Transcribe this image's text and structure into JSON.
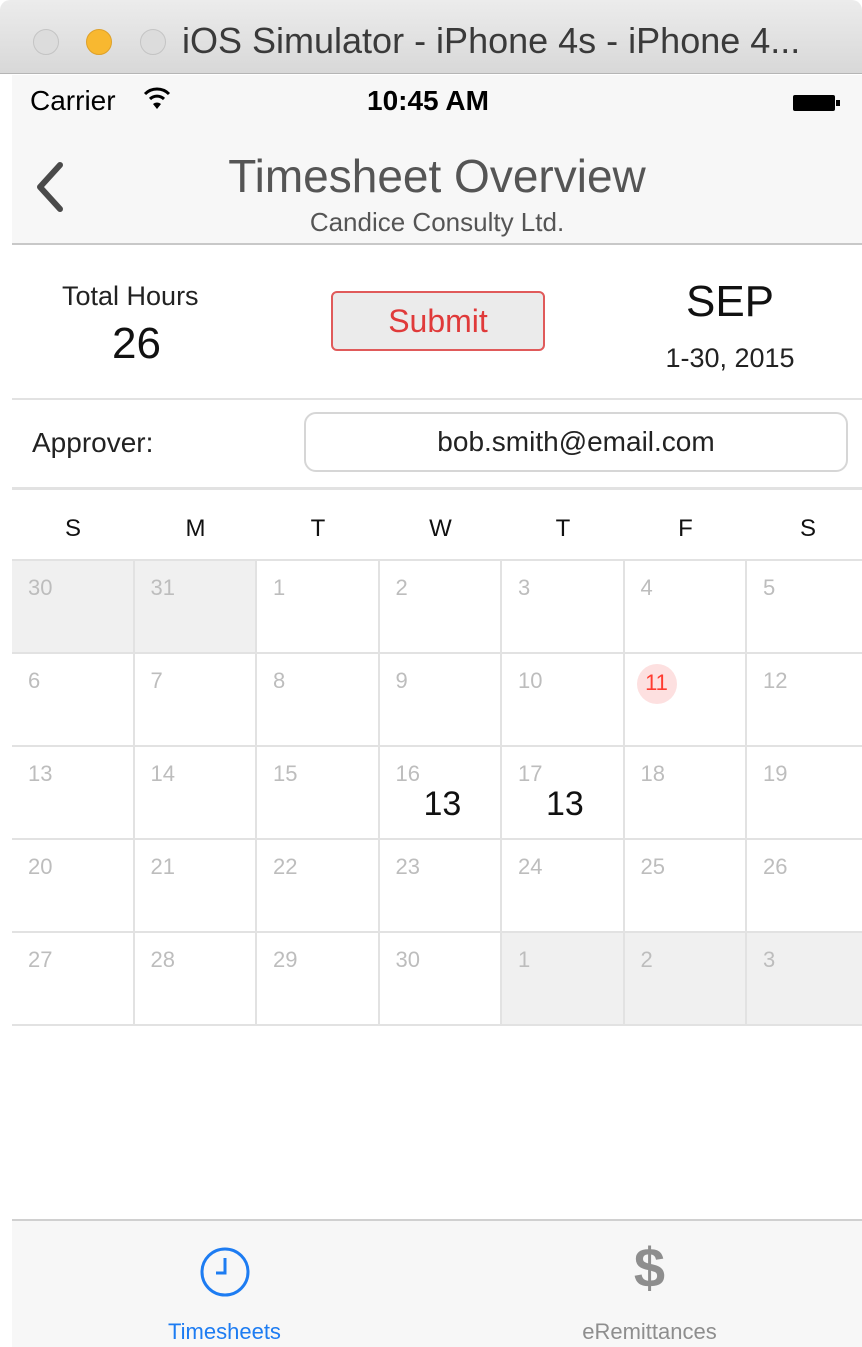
{
  "window": {
    "title": "iOS Simulator - iPhone 4s - iPhone 4..."
  },
  "status_bar": {
    "carrier": "Carrier",
    "time": "10:45 AM"
  },
  "nav": {
    "title": "Timesheet Overview",
    "subtitle": "Candice Consulty Ltd."
  },
  "summary": {
    "total_label": "Total Hours",
    "total_value": "26",
    "submit_label": "Submit",
    "month": "SEP",
    "range": "1-30, 2015"
  },
  "approver": {
    "label": "Approver:",
    "email": "bob.smith@email.com"
  },
  "calendar": {
    "weekdays": [
      "S",
      "M",
      "T",
      "W",
      "T",
      "F",
      "S"
    ],
    "weeks": [
      [
        {
          "day": "30",
          "out": true
        },
        {
          "day": "31",
          "out": true
        },
        {
          "day": "1"
        },
        {
          "day": "2"
        },
        {
          "day": "3"
        },
        {
          "day": "4"
        },
        {
          "day": "5"
        }
      ],
      [
        {
          "day": "6"
        },
        {
          "day": "7"
        },
        {
          "day": "8"
        },
        {
          "day": "9"
        },
        {
          "day": "10"
        },
        {
          "day": "11",
          "today": true
        },
        {
          "day": "12"
        }
      ],
      [
        {
          "day": "13"
        },
        {
          "day": "14"
        },
        {
          "day": "15"
        },
        {
          "day": "16",
          "hours": "13"
        },
        {
          "day": "17",
          "hours": "13"
        },
        {
          "day": "18"
        },
        {
          "day": "19"
        }
      ],
      [
        {
          "day": "20"
        },
        {
          "day": "21"
        },
        {
          "day": "22"
        },
        {
          "day": "23"
        },
        {
          "day": "24"
        },
        {
          "day": "25"
        },
        {
          "day": "26"
        }
      ],
      [
        {
          "day": "27"
        },
        {
          "day": "28"
        },
        {
          "day": "29"
        },
        {
          "day": "30"
        },
        {
          "day": "1",
          "out": true
        },
        {
          "day": "2",
          "out": true
        },
        {
          "day": "3",
          "out": true
        }
      ]
    ]
  },
  "tabs": [
    {
      "label": "Timesheets",
      "icon": "clock-icon",
      "active": true
    },
    {
      "label": "eRemittances",
      "icon": "dollar-icon",
      "glyph": "$",
      "active": false
    }
  ],
  "colors": {
    "accent": "#1d7cf2",
    "danger": "#e03a3a",
    "today_bg": "#fde0e0"
  }
}
